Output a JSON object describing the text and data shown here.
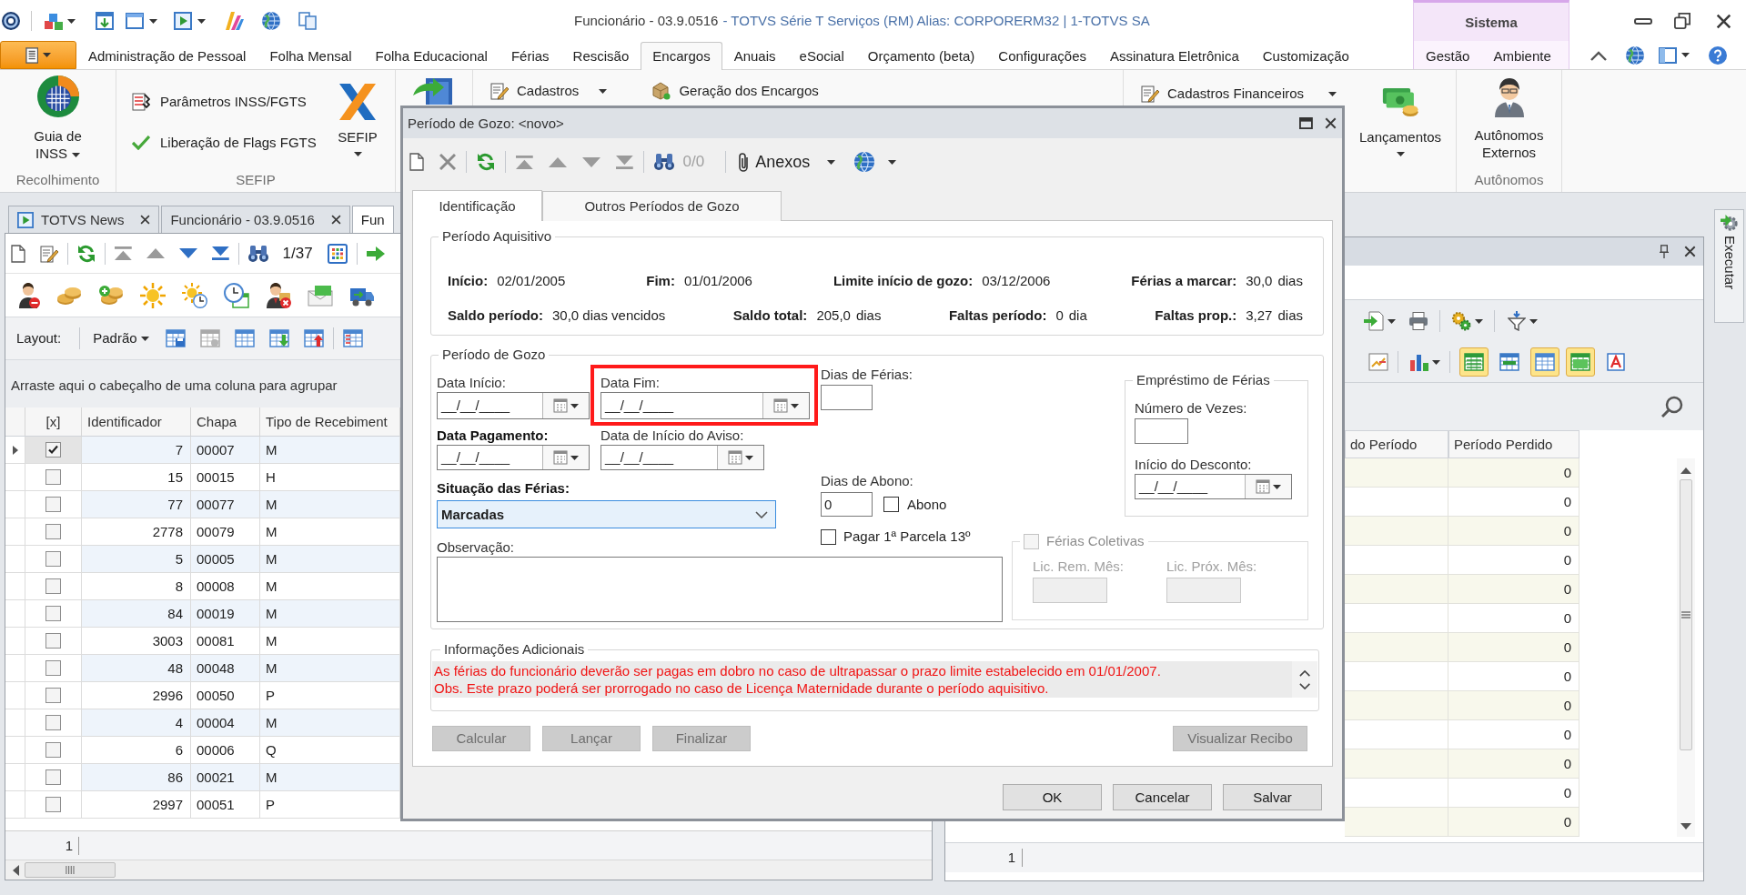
{
  "window": {
    "title_document": "Funcionário - 03.9.0516",
    "title_app": "- TOTVS Série T Serviços (RM) Alias: CORPORERM32 | 1-TOTVS SA",
    "context_title": "Sistema"
  },
  "menu": {
    "tabs": [
      {
        "label": "Administração de Pessoal",
        "selected": false
      },
      {
        "label": "Folha Mensal",
        "selected": false
      },
      {
        "label": "Folha Educacional",
        "selected": false
      },
      {
        "label": "Férias",
        "selected": false
      },
      {
        "label": "Rescisão",
        "selected": false
      },
      {
        "label": "Encargos",
        "selected": true
      },
      {
        "label": "Anuais",
        "selected": false
      },
      {
        "label": "eSocial",
        "selected": false
      },
      {
        "label": "Orçamento (beta)",
        "selected": false
      },
      {
        "label": "Configurações",
        "selected": false
      },
      {
        "label": "Assinatura Eletrônica",
        "selected": false
      },
      {
        "label": "Customização",
        "selected": false
      }
    ],
    "context_tabs": [
      {
        "label": "Gestão",
        "selected": false
      },
      {
        "label": "Ambiente",
        "selected": false
      }
    ]
  },
  "ribbon": {
    "recolhimento": {
      "label": "Recolhimento",
      "button": {
        "label": "Guia de INSS",
        "dropdown": true
      }
    },
    "sefip": {
      "label": "SEFIP",
      "commands": [
        {
          "label": "Parâmetros INSS/FGTS"
        },
        {
          "label": "Liberação de Flags FGTS"
        }
      ],
      "button": {
        "label": "SEFIP",
        "dropdown": true
      }
    },
    "encargos": {
      "commands": [
        {
          "label": "Cadastros",
          "dropdown": true
        },
        {
          "label": "Geração dos Encargos",
          "dropdown": false
        }
      ]
    },
    "financeiro": {
      "commands": [
        {
          "label": "Cadastros Financeiros",
          "dropdown": true
        }
      ],
      "button": {
        "label": "Lançamentos",
        "dropdown": true
      }
    },
    "autonomos": {
      "label": "Autônomos",
      "button": {
        "label": "Autônomos Externos",
        "dropdown": false
      }
    }
  },
  "doc_tabs": [
    {
      "label": "TOTVS News",
      "selected": false,
      "closable": true
    },
    {
      "label": "Funcionário - 03.9.0516",
      "selected": false,
      "closable": true
    },
    {
      "label": "Fun",
      "selected": true,
      "closable": false
    }
  ],
  "employee_grid": {
    "counter": "1/37",
    "layout_label": "Layout:",
    "layout_value": "Padrão",
    "group_hint": "Arraste aqui o cabeçalho de uma coluna para agrupar",
    "check_column": "[x]",
    "columns": [
      "Identificador",
      "Chapa",
      "Tipo de Recebiment"
    ],
    "rows": [
      {
        "selected": true,
        "checked": true,
        "cells": [
          "7",
          "00007",
          "M"
        ]
      },
      {
        "selected": false,
        "checked": false,
        "cells": [
          "15",
          "00015",
          "H"
        ]
      },
      {
        "selected": false,
        "checked": false,
        "cells": [
          "77",
          "00077",
          "M"
        ]
      },
      {
        "selected": false,
        "checked": false,
        "cells": [
          "2778",
          "00079",
          "M"
        ]
      },
      {
        "selected": false,
        "checked": false,
        "cells": [
          "5",
          "00005",
          "M"
        ]
      },
      {
        "selected": false,
        "checked": false,
        "cells": [
          "8",
          "00008",
          "M"
        ]
      },
      {
        "selected": false,
        "checked": false,
        "cells": [
          "84",
          "00019",
          "M"
        ]
      },
      {
        "selected": false,
        "checked": false,
        "cells": [
          "3003",
          "00081",
          "M"
        ]
      },
      {
        "selected": false,
        "checked": false,
        "cells": [
          "48",
          "00048",
          "M"
        ]
      },
      {
        "selected": false,
        "checked": false,
        "cells": [
          "2996",
          "00050",
          "P"
        ]
      },
      {
        "selected": false,
        "checked": false,
        "cells": [
          "4",
          "00004",
          "M"
        ]
      },
      {
        "selected": false,
        "checked": false,
        "cells": [
          "6",
          "00006",
          "Q"
        ]
      },
      {
        "selected": false,
        "checked": false,
        "cells": [
          "86",
          "00021",
          "M"
        ]
      },
      {
        "selected": false,
        "checked": false,
        "cells": [
          "2997",
          "00051",
          "P"
        ]
      }
    ],
    "footer": "1"
  },
  "side_panel": {
    "toggles": [
      {
        "on": true
      },
      {
        "on": false
      },
      {
        "on": true
      },
      {
        "on": true
      },
      {
        "on": false
      }
    ],
    "columns": [
      "do Período",
      "Período Perdido"
    ],
    "rows": [
      "0",
      "0",
      "0",
      "0",
      "0",
      "0",
      "0",
      "0",
      "0",
      "0",
      "0",
      "0",
      "0"
    ],
    "footer": "1"
  },
  "side_tab": {
    "label": "Executar"
  },
  "dialog": {
    "title": "Período de Gozo: <novo>",
    "counter": "0/0",
    "attachments": "Anexos",
    "tabs": [
      {
        "label": "Identificação",
        "selected": true
      },
      {
        "label": "Outros Períodos de Gozo",
        "selected": false
      }
    ],
    "aquisitivo": {
      "title": "Período Aquisitivo",
      "rows": [
        [
          {
            "label": "Início:",
            "value": "02/01/2005"
          },
          {
            "label": "Fim:",
            "value": "01/01/2006"
          },
          {
            "label": "Limite início de gozo:",
            "value": "03/12/2006"
          },
          {
            "label": "Férias a marcar:",
            "value": "30,0",
            "unit": "dias"
          }
        ],
        [
          {
            "label": "Saldo período:",
            "value": "30,0 dias vencidos"
          },
          {
            "label": "Saldo total:",
            "value": "205,0",
            "unit": "dias"
          },
          {
            "label": "Faltas período:",
            "value": "0",
            "unit": "dia"
          },
          {
            "label": "Faltas prop.:",
            "value": "3,27",
            "unit": "dias"
          }
        ]
      ]
    },
    "gozo": {
      "title": "Período de Gozo",
      "data_inicio": {
        "label": "Data Início:",
        "value": "__/__/____",
        "required": false
      },
      "data_fim": {
        "label": "Data Fim:",
        "value": "__/__/____",
        "required": false,
        "highlighted": true
      },
      "dias_ferias": {
        "label": "Dias de Férias:",
        "required": false
      },
      "data_pagamento": {
        "label": "Data Pagamento:",
        "value": "__/__/____",
        "required": true
      },
      "data_aviso": {
        "label": "Data de Início do Aviso:",
        "value": "__/__/____",
        "required": false
      },
      "dias_abono": {
        "label": "Dias de Abono:",
        "value": "0",
        "required": false
      },
      "abono": {
        "label": "Abono",
        "checked": false
      },
      "situacao": {
        "label": "Situação das Férias:",
        "value": "Marcadas",
        "required": true
      },
      "pagar_13": {
        "label": "Pagar 1ª Parcela 13º",
        "checked": false
      },
      "observacao": {
        "label": "Observação:",
        "required": false
      },
      "emprestimo": {
        "title": "Empréstimo de Férias",
        "numero_vezes": {
          "label": "Número de Vezes:"
        },
        "inicio_desconto": {
          "label": "Início do Desconto:",
          "value": "__/__/____"
        }
      },
      "coletivas": {
        "title": "Férias Coletivas",
        "checked": false,
        "disabled": true,
        "lic_rem": {
          "label": "Lic. Rem. Mês:"
        },
        "lic_prox": {
          "label": "Lic. Próx. Mês:"
        }
      }
    },
    "info": {
      "title": "Informações Adicionais",
      "lines": [
        "As férias do funcionário deverão ser pagas em dobro no caso de ultrapassar o prazo limite estabelecido em 01/01/2007.",
        "Obs. Este prazo poderá ser prorrogado no caso de Licença Maternidade durante o período aquisitivo."
      ]
    },
    "actions": [
      {
        "label": "Calcular",
        "disabled": true
      },
      {
        "label": "Lançar",
        "disabled": true
      },
      {
        "label": "Finalizar",
        "disabled": true
      }
    ],
    "preview": {
      "label": "Visualizar Recibo",
      "disabled": true
    },
    "buttons": [
      {
        "label": "OK"
      },
      {
        "label": "Cancelar"
      },
      {
        "label": "Salvar"
      }
    ]
  }
}
